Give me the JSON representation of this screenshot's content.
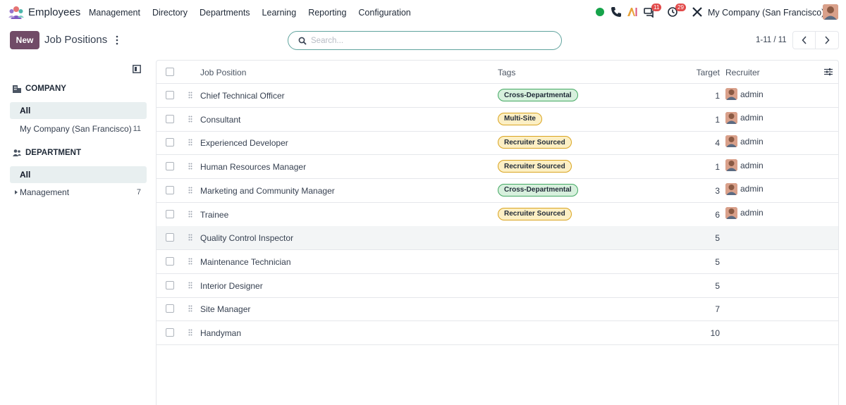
{
  "navbar": {
    "app_name": "Employees",
    "menu": [
      "Management",
      "Directory",
      "Departments",
      "Learning",
      "Reporting",
      "Configuration"
    ],
    "messages_count": "11",
    "activities_count": "29",
    "company": "My Company (San Francisco)"
  },
  "control": {
    "new_label": "New",
    "title": "Job Positions",
    "search_placeholder": "Search...",
    "pager": "1-11 / 11"
  },
  "sidebar": {
    "company": {
      "heading": "COMPANY",
      "all": "All",
      "items": [
        {
          "label": "My Company (San Francisco)",
          "count": "11"
        }
      ]
    },
    "department": {
      "heading": "DEPARTMENT",
      "all": "All",
      "items": [
        {
          "label": "Management",
          "count": "7"
        }
      ]
    }
  },
  "table": {
    "headers": {
      "name": "Job Position",
      "tags": "Tags",
      "target": "Target",
      "recruiter": "Recruiter"
    },
    "rows": [
      {
        "name": "Chief Technical Officer",
        "tag": "Cross-Departmental",
        "target": "1",
        "recruiter": "admin"
      },
      {
        "name": "Consultant",
        "tag": "Multi-Site",
        "target": "1",
        "recruiter": "admin"
      },
      {
        "name": "Experienced Developer",
        "tag": "Recruiter Sourced",
        "target": "4",
        "recruiter": "admin"
      },
      {
        "name": "Human Resources Manager",
        "tag": "Recruiter Sourced",
        "target": "1",
        "recruiter": "admin"
      },
      {
        "name": "Marketing and Community Manager",
        "tag": "Cross-Departmental",
        "target": "3",
        "recruiter": "admin"
      },
      {
        "name": "Trainee",
        "tag": "Recruiter Sourced",
        "target": "6",
        "recruiter": "admin"
      },
      {
        "name": "Quality Control Inspector",
        "tag": "",
        "target": "5",
        "recruiter": ""
      },
      {
        "name": "Maintenance Technician",
        "tag": "",
        "target": "5",
        "recruiter": ""
      },
      {
        "name": "Interior Designer",
        "tag": "",
        "target": "5",
        "recruiter": ""
      },
      {
        "name": "Site Manager",
        "tag": "",
        "target": "7",
        "recruiter": ""
      },
      {
        "name": "Handyman",
        "tag": "",
        "target": "10",
        "recruiter": ""
      }
    ]
  },
  "colors": {
    "brand": "#714b67",
    "tag_green_bg": "#d7f0dd",
    "tag_yellow_bg": "#fcefc4",
    "online": "#16a34a",
    "badge": "#e24b4b"
  }
}
